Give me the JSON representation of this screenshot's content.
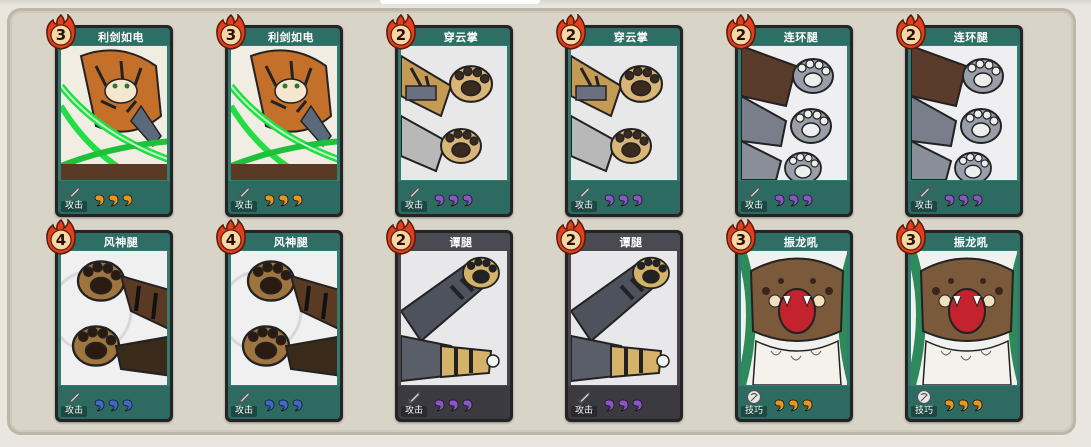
{
  "colors": {
    "panel": "#d9d4c8",
    "card_attack": "#347a70",
    "card_grey": "#47474d",
    "cost_fire": "#e0401f",
    "pip_orange": "#e8961e",
    "pip_purple": "#8a56c8",
    "pip_blue": "#3d6ad0"
  },
  "cards": [
    {
      "title": "利剑如电",
      "cost": "3",
      "type_label": "攻击",
      "type_icon": "sword-icon",
      "pip_color": "orange",
      "pips": 3,
      "art": "tiger-green-slash",
      "frame": "teal"
    },
    {
      "title": "利剑如电",
      "cost": "3",
      "type_label": "攻击",
      "type_icon": "sword-icon",
      "pip_color": "orange",
      "pips": 3,
      "art": "tiger-green-slash",
      "frame": "teal"
    },
    {
      "title": "穿云掌",
      "cost": "2",
      "type_label": "攻击",
      "type_icon": "sword-icon",
      "pip_color": "purple",
      "pips": 3,
      "art": "tan-paws",
      "frame": "teal"
    },
    {
      "title": "穿云掌",
      "cost": "2",
      "type_label": "攻击",
      "type_icon": "sword-icon",
      "pip_color": "purple",
      "pips": 3,
      "art": "tan-paws",
      "frame": "teal"
    },
    {
      "title": "连环腿",
      "cost": "2",
      "type_label": "攻击",
      "type_icon": "sword-icon",
      "pip_color": "purple",
      "pips": 3,
      "art": "grey-paws",
      "frame": "teal"
    },
    {
      "title": "连环腿",
      "cost": "2",
      "type_label": "攻击",
      "type_icon": "sword-icon",
      "pip_color": "purple",
      "pips": 3,
      "art": "grey-paws",
      "frame": "teal"
    },
    {
      "title": "风神腿",
      "cost": "4",
      "type_label": "攻击",
      "type_icon": "sword-icon",
      "pip_color": "blue",
      "pips": 3,
      "art": "brown-paws",
      "frame": "teal"
    },
    {
      "title": "风神腿",
      "cost": "4",
      "type_label": "攻击",
      "type_icon": "sword-icon",
      "pip_color": "blue",
      "pips": 3,
      "art": "brown-paws",
      "frame": "teal"
    },
    {
      "title": "谭腿",
      "cost": "2",
      "type_label": "攻击",
      "type_icon": "sword-icon",
      "pip_color": "purple",
      "pips": 3,
      "art": "striped-legs",
      "frame": "grey"
    },
    {
      "title": "谭腿",
      "cost": "2",
      "type_label": "攻击",
      "type_icon": "sword-icon",
      "pip_color": "purple",
      "pips": 3,
      "art": "striped-legs",
      "frame": "grey"
    },
    {
      "title": "振龙吼",
      "cost": "3",
      "type_label": "技巧",
      "type_icon": "technique-icon",
      "pip_color": "orange",
      "pips": 3,
      "art": "roaring-beast",
      "frame": "teal"
    },
    {
      "title": "振龙吼",
      "cost": "3",
      "type_label": "技巧",
      "type_icon": "technique-icon",
      "pip_color": "orange",
      "pips": 3,
      "art": "roaring-beast",
      "frame": "teal"
    }
  ]
}
